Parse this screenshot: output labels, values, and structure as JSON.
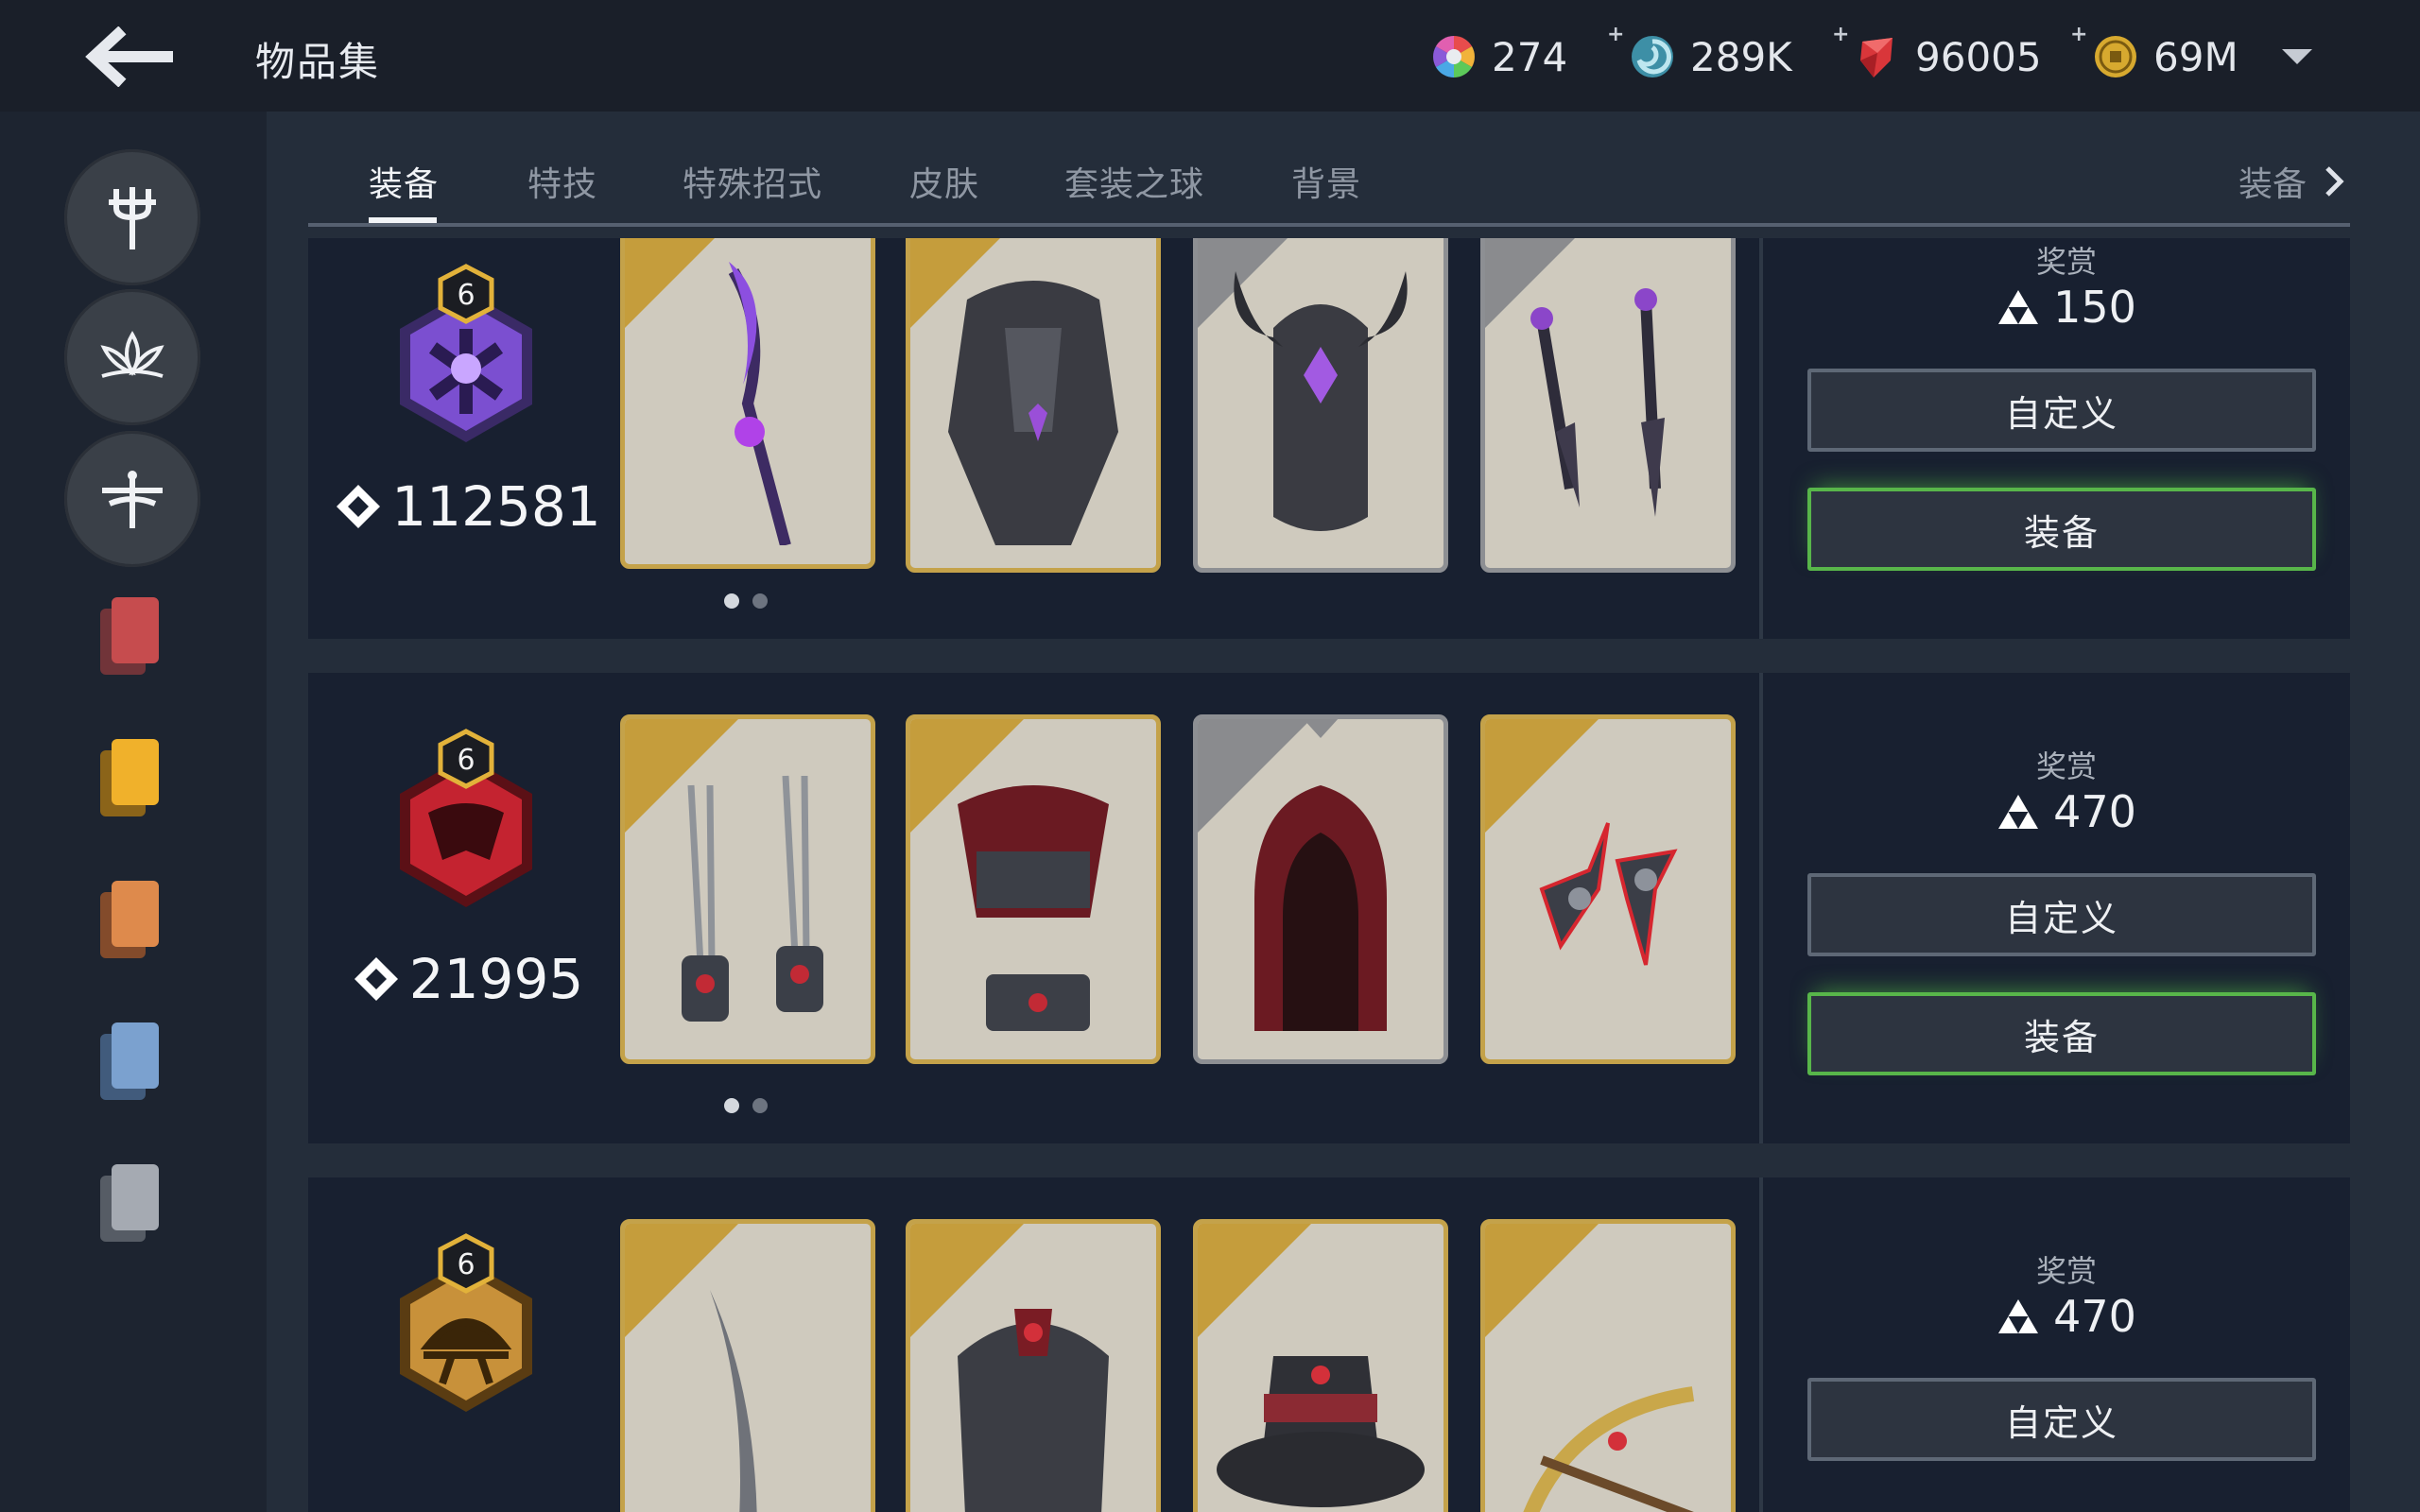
{
  "header": {
    "title": "物品集",
    "currencies": [
      {
        "icon": "rainbow-wheel-icon",
        "value": "274",
        "has_plus": false
      },
      {
        "icon": "spiral-token-icon",
        "value": "289K",
        "has_plus": true
      },
      {
        "icon": "red-gem-icon",
        "value": "96005",
        "has_plus": true
      },
      {
        "icon": "gold-coin-icon",
        "value": "69M",
        "has_plus": true
      }
    ]
  },
  "tabs": {
    "items": [
      "装备",
      "特技",
      "特殊招式",
      "皮肤",
      "套装之球",
      "背景"
    ],
    "active": "装备",
    "next_label": "装备"
  },
  "sidebar": {
    "buttons": [
      "trident-class-icon",
      "lotus-class-icon",
      "dragonfly-class-icon"
    ],
    "cards": [
      "red-card-icon",
      "yellow-card-icon",
      "orange-card-icon",
      "blue-card-icon",
      "gray-card-icon"
    ]
  },
  "rows": [
    {
      "badge_level": "6",
      "badge_color": "#7b4fd0",
      "score": "112581",
      "reward_label": "奖赏",
      "reward_value": "150",
      "customize_label": "自定义",
      "equip_label": "装备",
      "cards": [
        "purple-staff-icon",
        "dark-armor-icon",
        "horned-helmet-icon",
        "twin-daggers-icon"
      ]
    },
    {
      "badge_level": "6",
      "badge_color": "#c42330",
      "score": "21995",
      "reward_label": "奖赏",
      "reward_value": "470",
      "customize_label": "自定义",
      "equip_label": "装备",
      "cards": [
        "claw-gauntlets-icon",
        "red-scarf-armor-icon",
        "red-hood-icon",
        "shuriken-icon"
      ]
    },
    {
      "badge_level": "6",
      "badge_color": "#c8913a",
      "reward_label": "奖赏",
      "reward_value": "470",
      "customize_label": "自定义",
      "cards": [
        "blade-icon",
        "plate-armor-icon",
        "wide-hat-icon",
        "crossbow-icon"
      ]
    }
  ]
}
